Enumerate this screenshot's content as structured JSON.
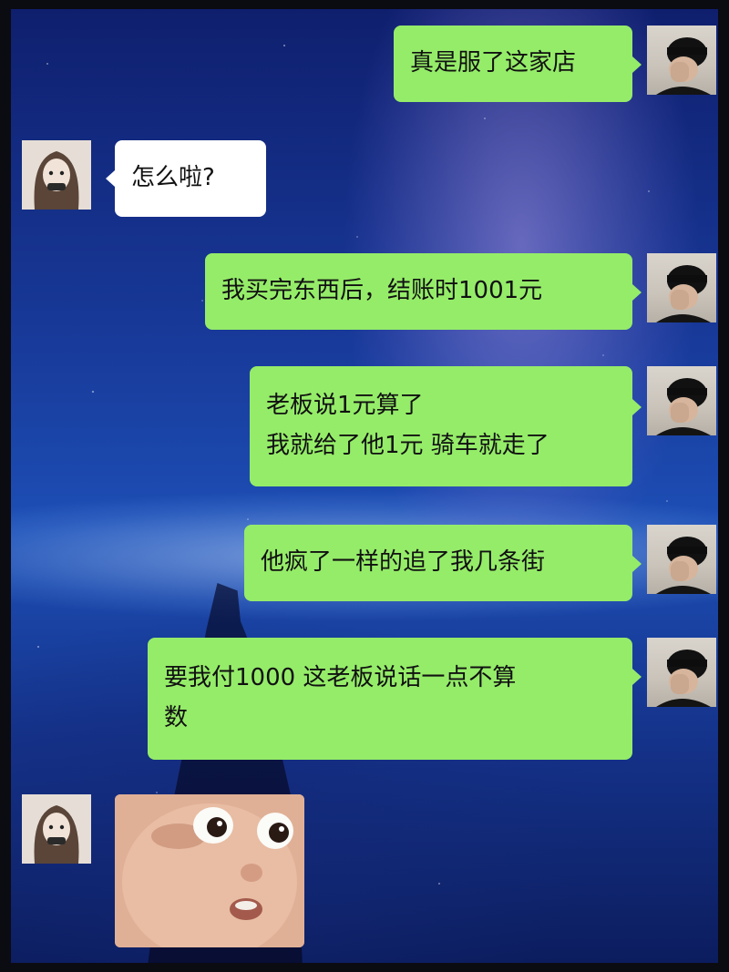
{
  "chat": {
    "messages": [
      {
        "sender": "me",
        "lines": [
          "真是服了这家店"
        ]
      },
      {
        "sender": "her",
        "lines": [
          "怎么啦?"
        ]
      },
      {
        "sender": "me",
        "lines": [
          "我买完东西后，结账时1001元"
        ]
      },
      {
        "sender": "me",
        "lines": [
          "老板说1元算了",
          "我就给了他1元 骑车就走了"
        ]
      },
      {
        "sender": "me",
        "lines": [
          "他疯了一样的追了我几条街"
        ]
      },
      {
        "sender": "me",
        "lines": [
          "要我付1000 这老板说话一点不算",
          "数"
        ]
      },
      {
        "sender": "her",
        "type": "sticker",
        "icon": "surprised-baby-sticker"
      }
    ]
  },
  "colors": {
    "outgoing_bubble": "#95ec69",
    "incoming_bubble": "#ffffff",
    "background": "#1d4fb6"
  }
}
